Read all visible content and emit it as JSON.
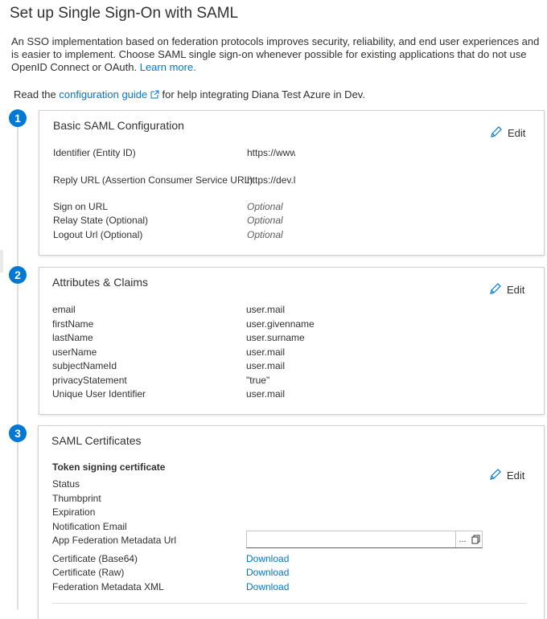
{
  "page": {
    "title": "Set up Single Sign-On with SAML",
    "intro": "An SSO implementation based on federation protocols improves security, reliability, and end user experiences and is easier to implement. Choose SAML single sign-on whenever possible for existing applications that do not use OpenID Connect or OAuth.",
    "learn_more": "Learn more.",
    "read_prefix": "Read the",
    "guide_link": "configuration guide",
    "read_suffix": "for help integrating Diana Test Azure in Dev."
  },
  "edit_label": "Edit",
  "sections": [
    {
      "number": "1",
      "title": "Basic SAML Configuration",
      "rows": [
        {
          "label": "Identifier (Entity ID)",
          "value": "https://www"
        },
        {
          "label": "Reply URL (Assertion Consumer Service URL)",
          "value": "https://dev.l"
        },
        {
          "label": "Sign on URL",
          "value": "Optional"
        },
        {
          "label": "Relay State (Optional)",
          "value": "Optional"
        },
        {
          "label": "Logout Url (Optional)",
          "value": "Optional"
        }
      ]
    },
    {
      "number": "2",
      "title": "Attributes & Claims",
      "rows": [
        {
          "label": "email",
          "value": "user.mail"
        },
        {
          "label": "firstName",
          "value": "user.givenname"
        },
        {
          "label": "lastName",
          "value": "user.surname"
        },
        {
          "label": "userName",
          "value": "user.mail"
        },
        {
          "label": "subjectNameId",
          "value": "user.mail"
        },
        {
          "label": "privacyStatement",
          "value": "\"true\""
        },
        {
          "label": "Unique User Identifier",
          "value": "user.mail"
        }
      ]
    },
    {
      "number": "3",
      "title": "SAML Certificates",
      "subheading": "Token signing certificate",
      "rows": [
        {
          "label": "Status"
        },
        {
          "label": "Thumbprint"
        },
        {
          "label": "Expiration"
        },
        {
          "label": "Notification Email"
        },
        {
          "label": "App Federation Metadata Url"
        },
        {
          "label": "Certificate (Base64)",
          "value": "Download"
        },
        {
          "label": "Certificate (Raw)",
          "value": "Download"
        },
        {
          "label": "Federation Metadata XML",
          "value": "Download"
        }
      ],
      "url_box": {
        "value": "",
        "more": "...",
        "copy_icon": "copy-icon"
      }
    }
  ],
  "icons": {
    "edit": "pencil-icon",
    "external": "external-link-icon"
  },
  "colors": {
    "accent": "#0078d4",
    "text": "#323130",
    "muted": "#605e5c"
  }
}
